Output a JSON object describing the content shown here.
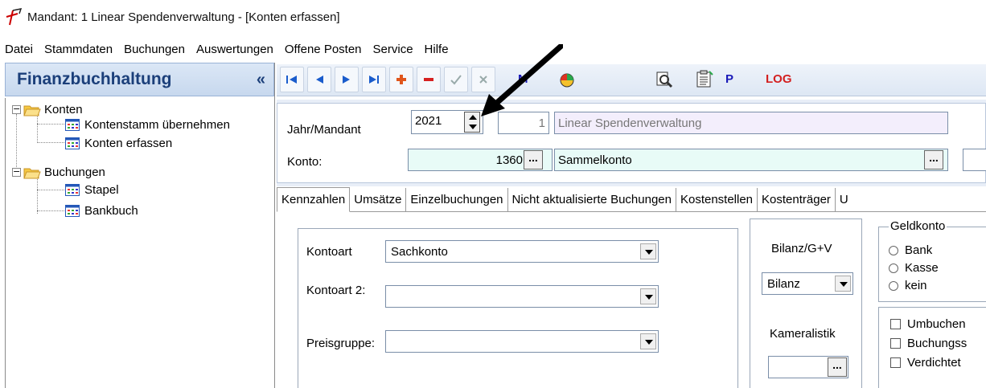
{
  "window": {
    "title": "Mandant: 1 Linear Spendenverwaltung - [Konten erfassen]"
  },
  "menu": [
    "Datei",
    "Stammdaten",
    "Buchungen",
    "Auswertungen",
    "Offene Posten",
    "Service",
    "Hilfe"
  ],
  "sidebar": {
    "header": "Finanzbuchhaltung",
    "collapse": "«",
    "tree": [
      {
        "label": "Konten"
      },
      {
        "label": "Kontenstamm übernehmen"
      },
      {
        "label": "Konten erfassen"
      },
      {
        "label": "Buchungen"
      },
      {
        "label": "Stapel"
      },
      {
        "label": "Bankbuch"
      }
    ]
  },
  "toolbar": {
    "m_label": "M",
    "p_label": "P",
    "log_label": "LOG"
  },
  "form": {
    "jahr_label": "Jahr/Mandant",
    "jahr_value": "2021",
    "mandant_value": "1",
    "mandant_name": "Linear Spendenverwaltung",
    "konto_label": "Konto:",
    "konto_value": "1360",
    "konto_name": "Sammelkonto",
    "ellipsis": "..."
  },
  "tabs": [
    "Kennzahlen",
    "Umsätze",
    "Einzelbuchungen",
    "Nicht aktualisierte Buchungen",
    "Kostenstellen",
    "Kostenträger",
    "U"
  ],
  "kennzahlen": {
    "kontoart_label": "Kontoart",
    "kontoart_value": "Sachkonto",
    "kontoart2_label": "Kontoart 2:",
    "kontoart2_value": "",
    "preisgruppe_label": "Preisgruppe:",
    "preisgruppe_value": "",
    "bilanz_label": "Bilanz/G+V",
    "bilanz_value": "Bilanz",
    "kameralistik_label": "Kameralistik",
    "geldkonto_label": "Geldkonto",
    "geldkonto_options": [
      "Bank",
      "Kasse",
      "kein"
    ],
    "checkboxes": [
      "Umbuchen",
      "Buchungss",
      "Verdichtet"
    ]
  },
  "colors": {
    "accent": "#1b3f7a",
    "record_add": "#e0561c",
    "record_delete": "#d62020",
    "log": "#d32020",
    "mp": "#1a1ab8"
  }
}
